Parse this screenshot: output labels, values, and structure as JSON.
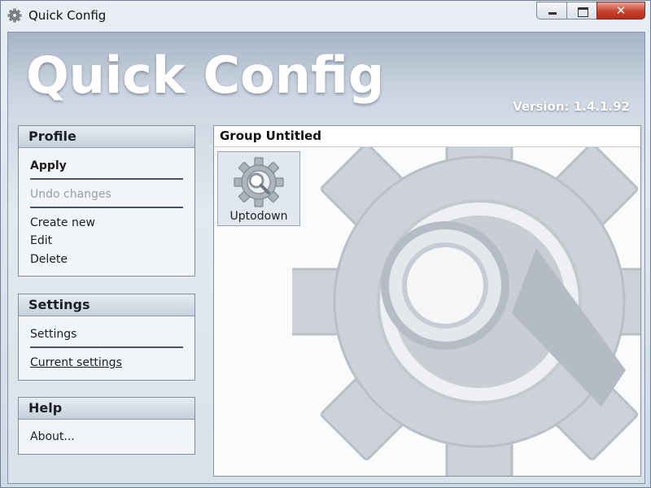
{
  "window": {
    "title": "Quick Config",
    "icon": "gear-icon",
    "controls": {
      "minimize": "minimize-icon",
      "maximize": "maximize-icon",
      "close": "✕"
    }
  },
  "header": {
    "app_title": "Quick Config",
    "version": "Version: 1.4.1.92"
  },
  "sidebar": {
    "profile": {
      "title": "Profile",
      "items": [
        "Apply",
        "Undo changes",
        "Create new",
        "Edit",
        "Delete"
      ]
    },
    "settings": {
      "title": "Settings",
      "items": [
        "Settings",
        "Current settings"
      ]
    },
    "help": {
      "title": "Help",
      "items": [
        "About..."
      ]
    }
  },
  "main": {
    "group_title": "Group Untitled",
    "tiles": [
      {
        "label": "Uptodown",
        "icon": "gear-magnifier-icon"
      }
    ]
  },
  "colors": {
    "panel_header": "#c5cfdb",
    "gear": "#c7ccd3",
    "close_button": "#c9402d"
  }
}
